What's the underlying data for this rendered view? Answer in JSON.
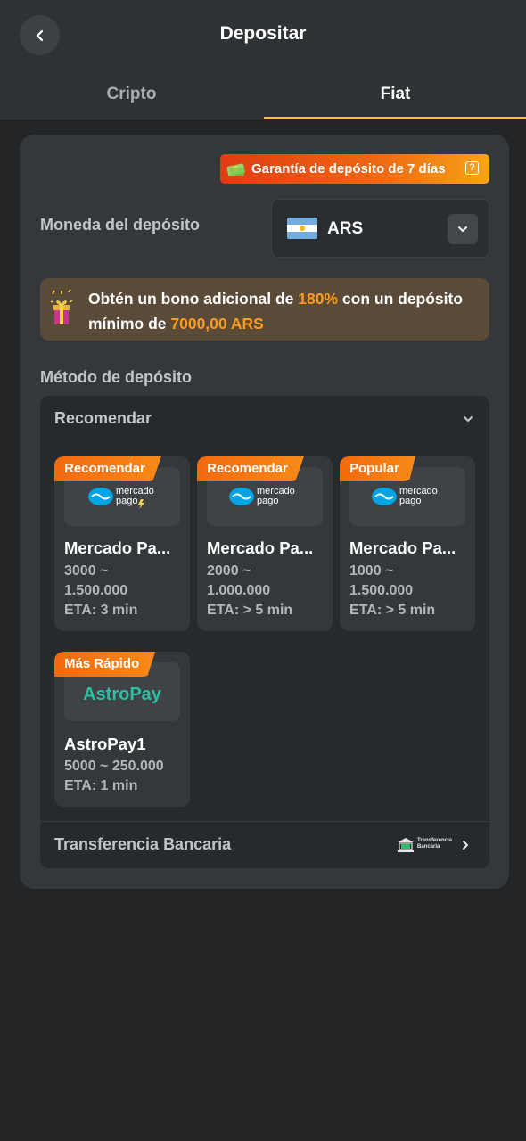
{
  "header": {
    "title": "Depositar"
  },
  "tabs": [
    {
      "label": "Cripto",
      "active": false
    },
    {
      "label": "Fiat",
      "active": true
    }
  ],
  "deposit": {
    "guarantee_label": "Garantía de depósito de 7 días",
    "currency_label": "Moneda del depósito",
    "currency_code": "ARS",
    "bonus": {
      "text_1": "Obtén un bono adicional de ",
      "percent": "180%",
      "text_2": " con un depósito mínimo de ",
      "min_amount": "7000,00 ARS"
    },
    "method_label": "Método de depósito",
    "group_title": "Recomendar",
    "methods": [
      {
        "badge": "Recomendar",
        "logo": "mercado pago",
        "name": "Mercado Pa...",
        "range_1": "3000 ~",
        "range_2": "1.500.000",
        "eta": "ETA: 3 min"
      },
      {
        "badge": "Recomendar",
        "logo": "mercado pago",
        "name": "Mercado Pa...",
        "range_1": "2000 ~",
        "range_2": "1.000.000",
        "eta": "ETA: > 5 min"
      },
      {
        "badge": "Popular",
        "logo": "mercado pago",
        "name": "Mercado Pa...",
        "range_1": "1000 ~",
        "range_2": "1.500.000",
        "eta": "ETA: > 5 min"
      },
      {
        "badge": "Más Rápido",
        "logo": "AstroPay",
        "name": "AstroPay1",
        "range_1": "5000 ~ 250.000",
        "range_2": "",
        "eta": "ETA: 1 min"
      }
    ],
    "bank_transfer": {
      "label": "Transferencia Bancaria",
      "icon_text_1": "Transferencia",
      "icon_text_2": "Bancaria"
    }
  },
  "colors": {
    "accent_yellow": "#f6c12b",
    "highlight_orange": "#ff9a1a",
    "badge_orange": "#f2690f",
    "astropay_teal": "#2bbfa4",
    "mercadopago_blue": "#00a4e0"
  }
}
